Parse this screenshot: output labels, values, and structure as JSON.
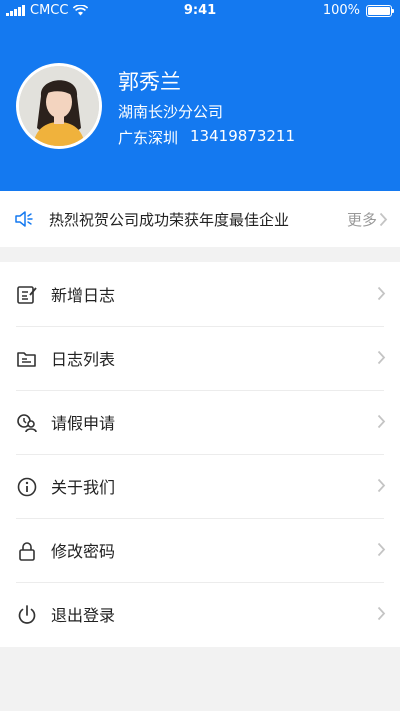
{
  "status_bar": {
    "carrier": "CMCC",
    "time": "9:41",
    "battery": "100%"
  },
  "profile": {
    "name": "郭秀兰",
    "company": "湖南长沙分公司",
    "location": "广东深圳",
    "phone": "13419873211"
  },
  "notice": {
    "text": "热烈祝贺公司成功荣获年度最佳企业",
    "more_label": "更多"
  },
  "menu": {
    "items": [
      {
        "label": "新增日志",
        "icon": "edit-log-icon"
      },
      {
        "label": "日志列表",
        "icon": "folder-icon"
      },
      {
        "label": "请假申请",
        "icon": "leave-request-icon"
      },
      {
        "label": "关于我们",
        "icon": "info-icon"
      },
      {
        "label": "修改密码",
        "icon": "lock-icon"
      },
      {
        "label": "退出登录",
        "icon": "power-icon"
      }
    ]
  },
  "colors": {
    "header": "#1479f0",
    "background": "#f2f2f2",
    "icon_gray": "#333333"
  }
}
